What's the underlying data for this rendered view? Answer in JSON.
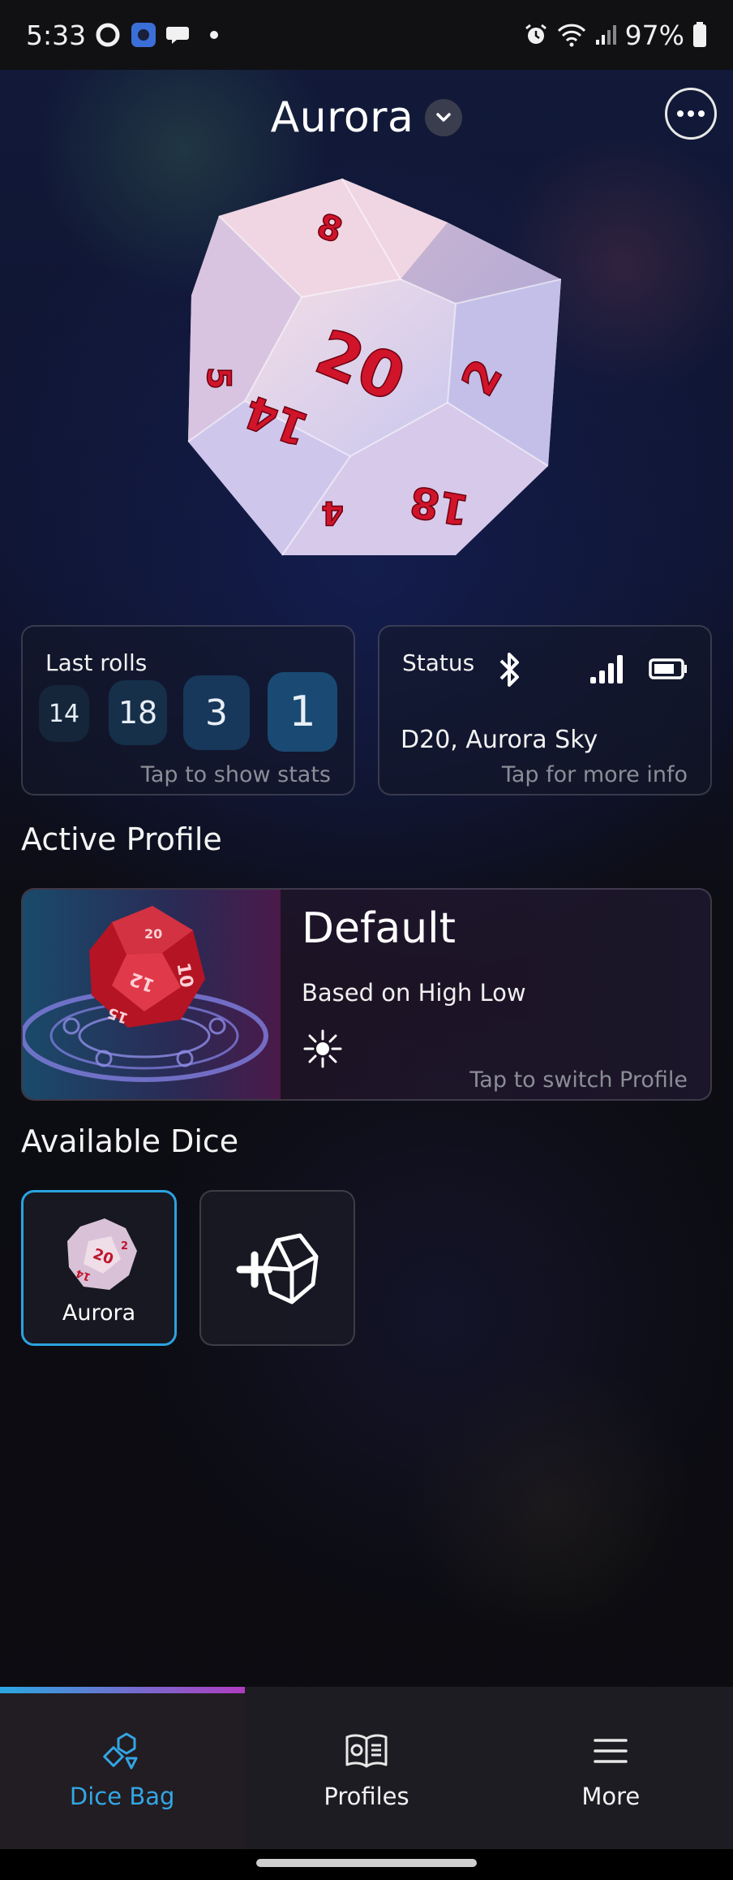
{
  "status_bar": {
    "time": "5:33",
    "battery": "97%",
    "icons": [
      "ring-icon",
      "app-icon",
      "chat-bubble-icon",
      "dot-icon",
      "alarm-icon",
      "wifi-icon",
      "signal-icon",
      "battery-icon"
    ]
  },
  "header": {
    "dice_name": "Aurora",
    "dropdown_icon": "chevron-down-icon",
    "more_icon": "more-horizontal-icon"
  },
  "last_rolls": {
    "title": "Last rolls",
    "values": [
      "14",
      "18",
      "3",
      "1"
    ],
    "hint": "Tap to show stats"
  },
  "status": {
    "title": "Status",
    "die": "D20, Aurora Sky",
    "hint": "Tap for more info",
    "icons": [
      "bluetooth-icon",
      "signal-strength-icon",
      "battery-icon"
    ]
  },
  "active_profile": {
    "section_title": "Active Profile",
    "name": "Default",
    "based_on": "Based on High Low",
    "hint": "Tap to switch Profile",
    "icon": "sparkle-icon"
  },
  "available_dice": {
    "section_title": "Available Dice",
    "dice": [
      {
        "label": "Aurora",
        "selected": true
      },
      {
        "label": "",
        "icon": "add-die-icon"
      }
    ]
  },
  "nav": {
    "items": [
      {
        "label": "Dice Bag",
        "icon": "dice-bag-icon",
        "active": true
      },
      {
        "label": "Profiles",
        "icon": "profiles-book-icon",
        "active": false
      },
      {
        "label": "More",
        "icon": "menu-icon",
        "active": false
      }
    ]
  },
  "colors": {
    "accent": "#2ba3e0",
    "die_red": "#d0142a",
    "nav_bg": "#1c1c22"
  }
}
